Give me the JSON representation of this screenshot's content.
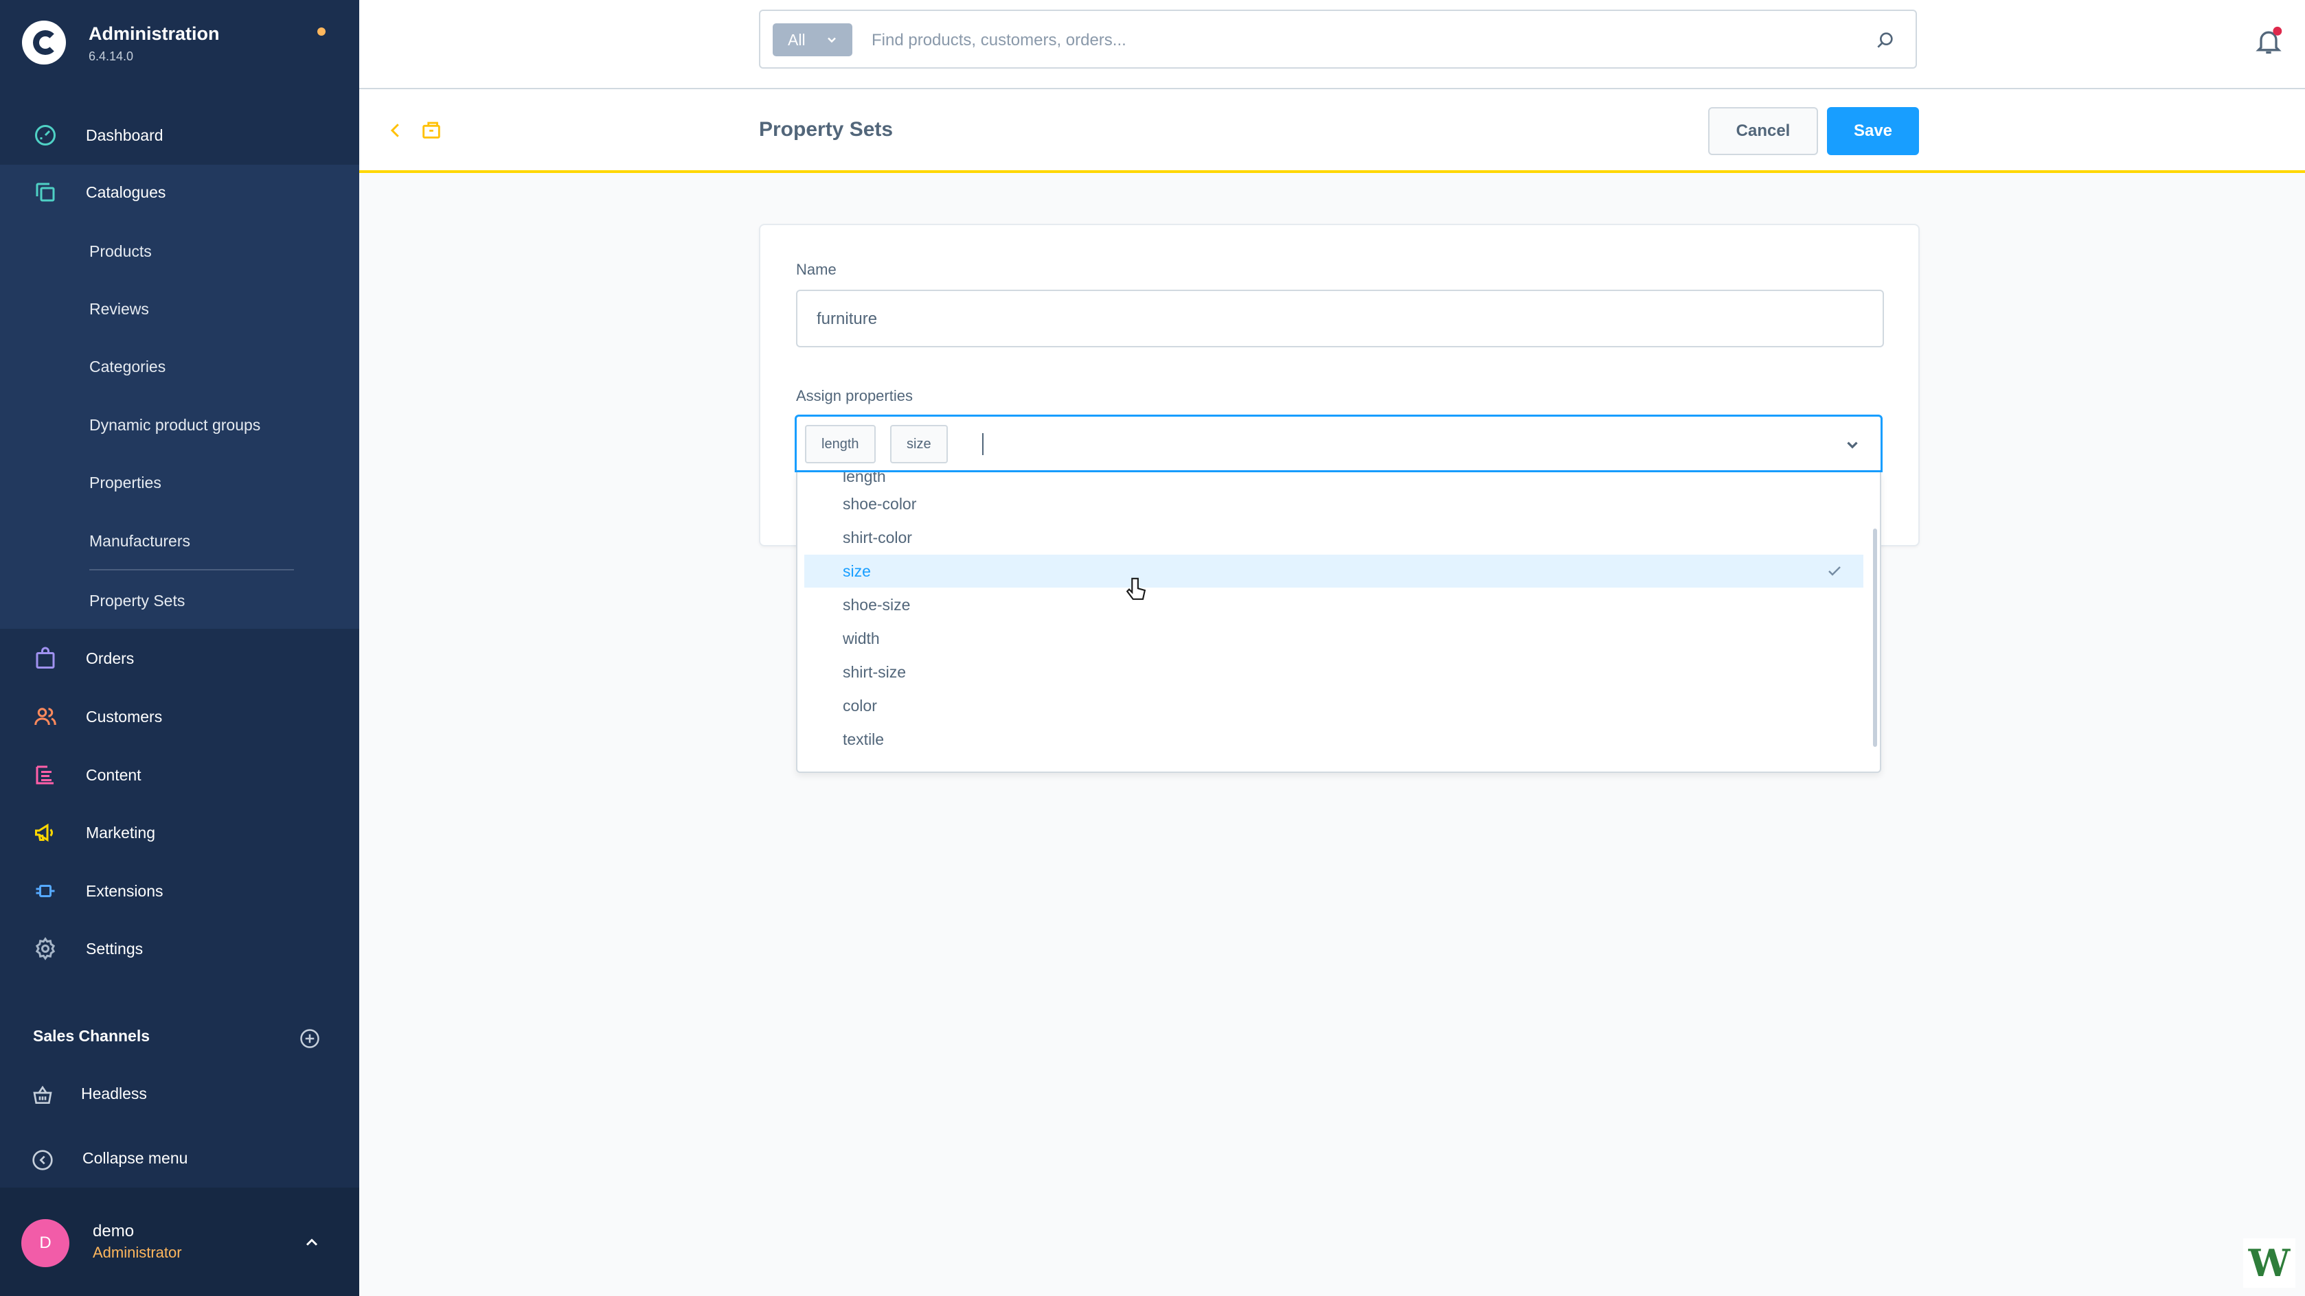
{
  "brand": {
    "title": "Administration",
    "version": "6.4.14.0"
  },
  "sidebar": {
    "items": [
      {
        "label": "Dashboard",
        "icon": "dashboard-icon"
      },
      {
        "label": "Catalogues",
        "icon": "catalogue-icon"
      },
      {
        "label": "Orders",
        "icon": "orders-icon"
      },
      {
        "label": "Customers",
        "icon": "customers-icon"
      },
      {
        "label": "Content",
        "icon": "content-icon"
      },
      {
        "label": "Marketing",
        "icon": "marketing-icon"
      },
      {
        "label": "Extensions",
        "icon": "extensions-icon"
      },
      {
        "label": "Settings",
        "icon": "settings-icon"
      }
    ],
    "catalogue_sub": [
      "Products",
      "Reviews",
      "Categories",
      "Dynamic product groups",
      "Properties",
      "Manufacturers",
      "Property Sets"
    ],
    "sales_channels_header": "Sales Channels",
    "sales_channel_item": "Headless",
    "collapse_label": "Collapse menu"
  },
  "user": {
    "initial": "D",
    "name": "demo",
    "role": "Administrator"
  },
  "search": {
    "type_label": "All",
    "placeholder": "Find products, customers, orders..."
  },
  "smartbar": {
    "title": "Property Sets",
    "cancel_label": "Cancel",
    "save_label": "Save"
  },
  "form": {
    "name_label": "Name",
    "name_value": "furniture",
    "assign_label": "Assign properties",
    "tags": [
      "length",
      "size"
    ],
    "options_partial_top": "length",
    "options": [
      "shoe-color",
      "shirt-color",
      "size",
      "shoe-size",
      "width",
      "shirt-size",
      "color",
      "textile"
    ],
    "selected_option": "size"
  },
  "colors": {
    "sidebar_bg": "#1b2f4f",
    "accent_blue": "#189eff",
    "smartbar_border": "#ffd700",
    "badge_orange": "#ffb75d",
    "avatar_pink": "#f25ca8"
  },
  "watermark": "W"
}
